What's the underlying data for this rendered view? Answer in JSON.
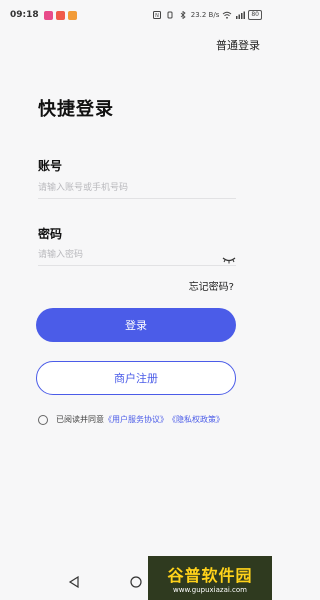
{
  "status_bar": {
    "time": "09:18",
    "net_speed": "23.2 B/s",
    "battery": "80"
  },
  "header": {
    "switch_login_link": "普通登录"
  },
  "title": "快捷登录",
  "account": {
    "label": "账号",
    "placeholder": "请输入账号或手机号码"
  },
  "password": {
    "label": "密码",
    "placeholder": "请输入密码"
  },
  "forgot_password": "忘记密码?",
  "login_button": "登录",
  "register_button": "商户注册",
  "agreement": {
    "prefix": "已阅读并同意",
    "user_agreement": "《用户服务协议》",
    "privacy_policy": "《隐私权政策》"
  },
  "watermark": {
    "main": "谷普软件园",
    "sub": "www.gupuxiazai.com"
  },
  "colors": {
    "accent": "#4b5ce8"
  }
}
